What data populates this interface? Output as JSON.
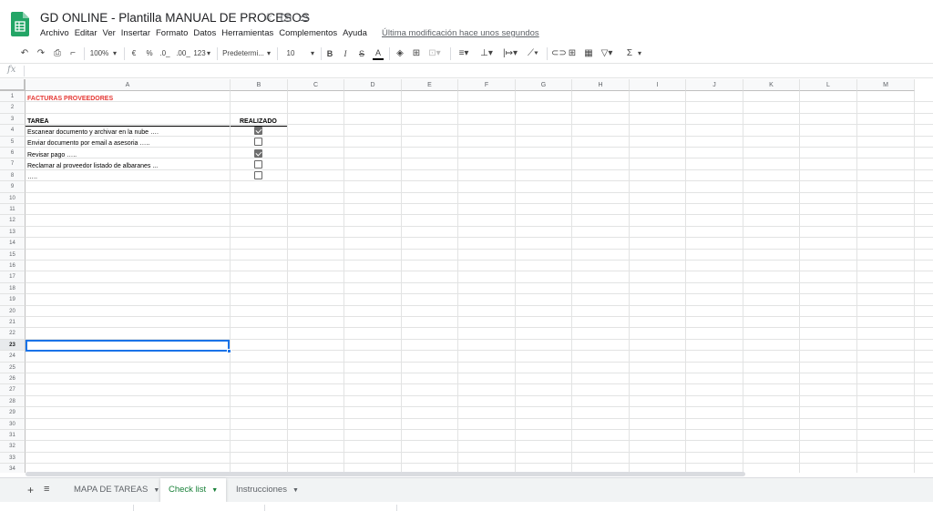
{
  "header": {
    "title": "GD ONLINE - Plantilla MANUAL DE PROCESOS",
    "icons": [
      "star-icon",
      "folder-icon",
      "cloud-icon"
    ],
    "menu": [
      "Archivo",
      "Editar",
      "Ver",
      "Insertar",
      "Formato",
      "Datos",
      "Herramientas",
      "Complementos",
      "Ayuda"
    ],
    "last_edit": "Última modificación hace unos segundos"
  },
  "toolbar": {
    "zoom": "100%",
    "currency": "€",
    "percent": "%",
    "dec_less": ".0_",
    "dec_more": ".00_",
    "format_more": "123",
    "font": "Predetermi...",
    "font_size": "10",
    "bold": "B",
    "italic": "I",
    "strike": "S",
    "text_color": "A",
    "sum": "Σ"
  },
  "formula_bar": {
    "fx": "fx",
    "value": ""
  },
  "grid": {
    "columns": [
      "A",
      "B",
      "C",
      "D",
      "E",
      "F",
      "G",
      "H",
      "I",
      "J",
      "K",
      "L",
      "M"
    ],
    "rows": [
      "1",
      "2",
      "3",
      "4",
      "5",
      "6",
      "7",
      "8",
      "9",
      "10",
      "11",
      "12",
      "13",
      "14",
      "15",
      "16",
      "17",
      "18",
      "19",
      "20",
      "21",
      "22",
      "23",
      "24",
      "25",
      "26",
      "27",
      "28",
      "29",
      "30",
      "31",
      "32",
      "33",
      "34"
    ],
    "selected_row": "23",
    "cells": {
      "a1": "FACTURAS PROVEEDORES",
      "a3": "TAREA",
      "b3": "REALIZADO",
      "a4": "Escanear documento y archivar en la nube ….",
      "a5": "Enviar documento por email a asesoria …..",
      "a6": "Revisar pago …..",
      "a7": "Reclamar al proveedor listado de albaranes ...",
      "a8": "….."
    },
    "checkboxes": [
      true,
      false,
      true,
      false,
      false
    ],
    "accent_color": "#1a73e8",
    "title_color": "#e53935"
  },
  "tabs": {
    "items": [
      "MAPA DE TAREAS",
      "Check list",
      "Instrucciones"
    ],
    "active": "Check list",
    "active_color": "#188038"
  }
}
